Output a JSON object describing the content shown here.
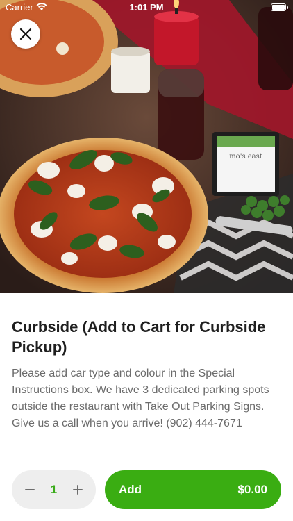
{
  "status_bar": {
    "carrier": "Carrier",
    "time": "1:01 PM"
  },
  "hero": {
    "image_subject": "pizza-with-basil-and-mozzarella-on-festive-table",
    "sign_text": "mo's east"
  },
  "item": {
    "title": "Curbside (Add to Cart for Curbside Pickup)",
    "description": "Please add car type and colour in the Special Instructions box.  We have 3 dedicated parking spots outside the restaurant with Take Out Parking Signs. Give us a call when you arrive! (902) 444-7671"
  },
  "quantity": {
    "value": "1"
  },
  "add_button": {
    "label": "Add",
    "price": "$0.00"
  },
  "colors": {
    "accent_green": "#3aad12",
    "stepper_bg": "#eeeeee",
    "title_text": "#1f1f1f",
    "body_text": "#6b6b6b"
  },
  "icons": {
    "close": "close-icon",
    "minus": "minus-icon",
    "plus": "plus-icon",
    "wifi": "wifi-icon",
    "battery": "battery-icon"
  }
}
